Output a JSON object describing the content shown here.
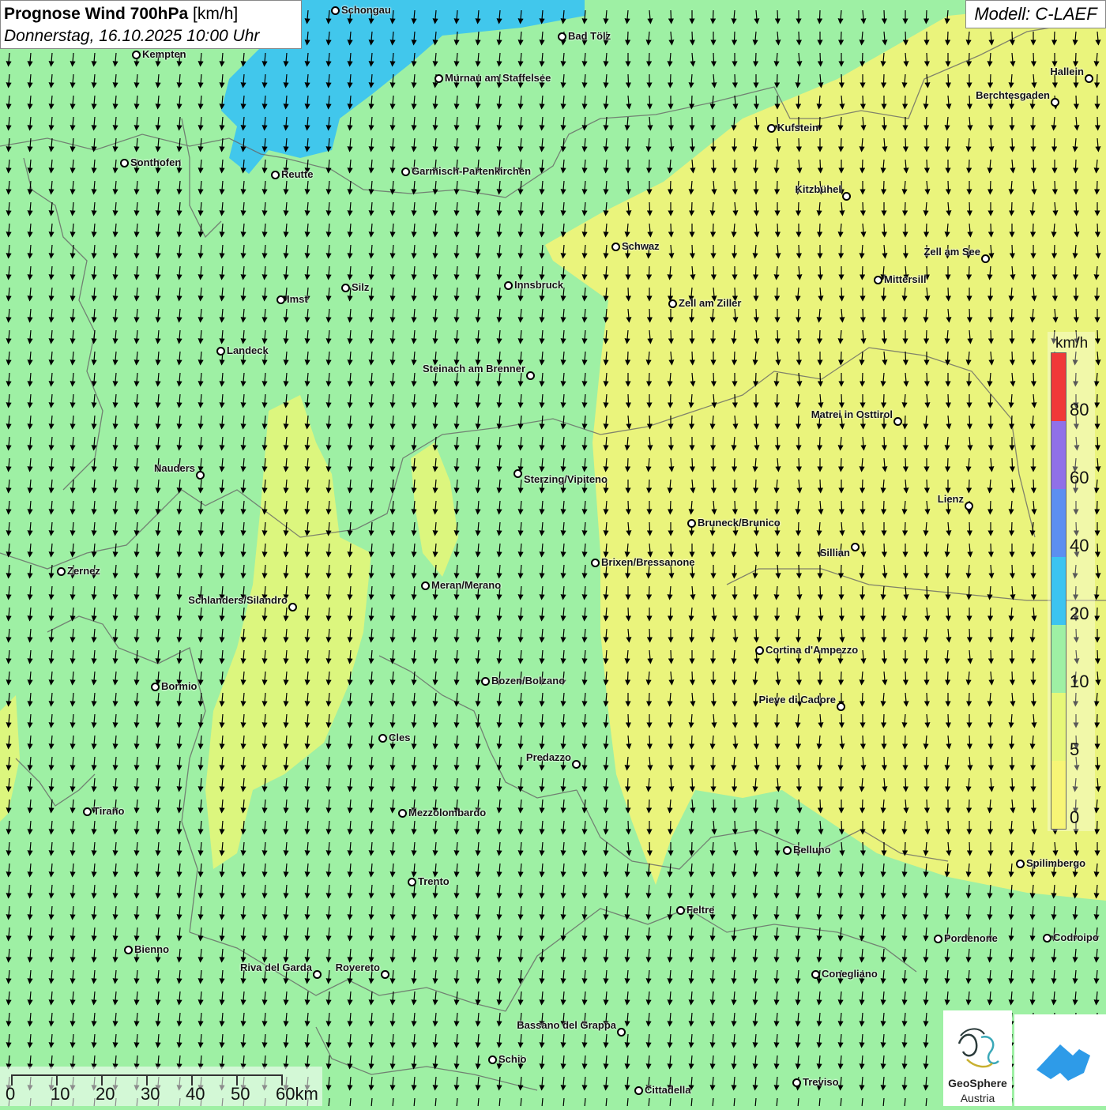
{
  "header": {
    "title_bold": "Prognose Wind 700hPa",
    "title_unit": "[km/h]",
    "datetime": "Donnerstag, 16.10.2025 10:00 Uhr",
    "model": "Modell: C-LAEF"
  },
  "colors": {
    "wind_0_5": "#f7f576",
    "wind_5_10": "#e6f778",
    "wind_10_20": "#9ef0a4",
    "wind_20_40": "#3cc4f0",
    "wind_40_60": "#5c8ff0",
    "wind_60_80": "#9070e8",
    "wind_80_plus": "#f03838"
  },
  "legend": {
    "unit": "km/h",
    "labels": [
      "80",
      "60",
      "40",
      "20",
      "10",
      "5",
      "0"
    ],
    "segments": [
      "#f03838",
      "#9070e8",
      "#5c8ff0",
      "#3cc4f0",
      "#9ef0a4",
      "#e6f778",
      "#f7f576"
    ]
  },
  "scale_bar": {
    "labels": [
      "0",
      "10",
      "20",
      "30",
      "40",
      "50",
      "60km"
    ]
  },
  "logos": {
    "geosphere_line1": "GeoSphere",
    "geosphere_line2": "Austria"
  },
  "cities": [
    {
      "name": "Schongau"
    },
    {
      "name": "Bad Tölz"
    },
    {
      "name": "Kempten"
    },
    {
      "name": "Murnau am Staffelsee"
    },
    {
      "name": "Hallein"
    },
    {
      "name": "Berchtesgaden"
    },
    {
      "name": "Kufstein"
    },
    {
      "name": "Sonthofen"
    },
    {
      "name": "Reutte"
    },
    {
      "name": "Garmisch-Partenkirchen"
    },
    {
      "name": "Kitzbühel"
    },
    {
      "name": "Schwaz"
    },
    {
      "name": "Zell am See"
    },
    {
      "name": "Mittersill"
    },
    {
      "name": "Imst"
    },
    {
      "name": "Silz"
    },
    {
      "name": "Innsbruck"
    },
    {
      "name": "Zell am Ziller"
    },
    {
      "name": "Landeck"
    },
    {
      "name": "Steinach am Brenner"
    },
    {
      "name": "Matrei in Osttirol"
    },
    {
      "name": "Nauders"
    },
    {
      "name": "Sterzing/Vipiteno"
    },
    {
      "name": "Lienz"
    },
    {
      "name": "Bruneck/Brunico"
    },
    {
      "name": "Sillian"
    },
    {
      "name": "Zernez"
    },
    {
      "name": "Brixen/Bressanone"
    },
    {
      "name": "Meran/Merano"
    },
    {
      "name": "Schlanders/Silandro"
    },
    {
      "name": "Cortina d'Ampezzo"
    },
    {
      "name": "Bozen/Bolzano"
    },
    {
      "name": "Bormio"
    },
    {
      "name": "Pieve di Cadore"
    },
    {
      "name": "Cles"
    },
    {
      "name": "Predazzo"
    },
    {
      "name": "Tirano"
    },
    {
      "name": "Mezzolombardo"
    },
    {
      "name": "Belluno"
    },
    {
      "name": "Spilimbergo"
    },
    {
      "name": "Trento"
    },
    {
      "name": "Feltre"
    },
    {
      "name": "Pordenone"
    },
    {
      "name": "Codroipo"
    },
    {
      "name": "Bienno"
    },
    {
      "name": "Riva del Garda"
    },
    {
      "name": "Rovereto"
    },
    {
      "name": "Conegliano"
    },
    {
      "name": "Bassano del Grappa"
    },
    {
      "name": "Schio"
    },
    {
      "name": "Treviso"
    },
    {
      "name": "Cittadella"
    }
  ]
}
